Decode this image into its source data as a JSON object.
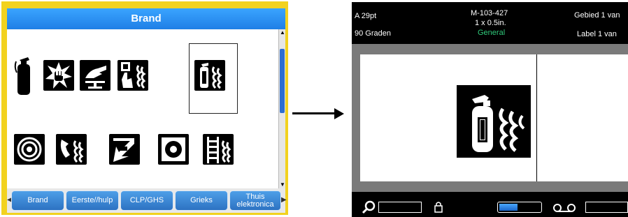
{
  "left_screen": {
    "title": "Brand",
    "symbols_row1": [
      "fire-extinguisher",
      "fire-alarm-press",
      "fire-hand-signal",
      "fire-alarm-button",
      "fire-extinguisher-flames"
    ],
    "symbols_row2": [
      "fire-hose",
      "fire-emergency-phone",
      "fire-direction-arrow",
      "fire-hose-reel",
      "fire-ladder"
    ],
    "selected_index": 4,
    "tabs": [
      {
        "label": "Brand"
      },
      {
        "label": "Eerste//hulp"
      },
      {
        "label": "CLP/GHS"
      },
      {
        "label": "Grieks"
      },
      {
        "label": "Thuis elektronica"
      }
    ],
    "colors": {
      "frame": "#f2d21f",
      "title_bar": "#2b8ef3",
      "tab": "#3b86d6"
    }
  },
  "right_screen": {
    "top_left_1": "A 29pt",
    "top_left_2": "90 Graden",
    "center_1": "M-103-427",
    "center_2": "1 x 0.5in.",
    "center_3": "General",
    "top_right_1": "Gebied 1 van",
    "top_right_2": "Label 1 van",
    "canvas_symbol": "fire-extinguisher-flames",
    "status_icons": [
      "zoom-icon",
      "lock-icon",
      "battery-icon",
      "tape-icon"
    ]
  }
}
